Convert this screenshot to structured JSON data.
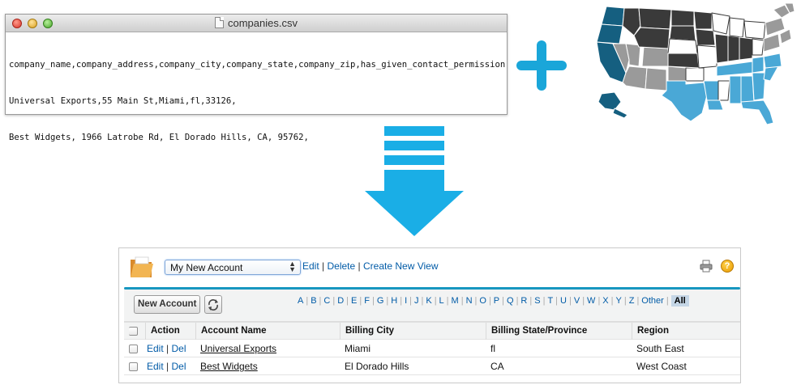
{
  "csv_window": {
    "title": "companies.csv",
    "lines": [
      "company_name,company_address,company_city,company_state,company_zip,has_given_contact_permission",
      "Universal Exports,55 Main St,Miami,fl,33126,",
      "Best Widgets, 1966 Latrobe Rd, El Dorado Hills, CA, 95762,"
    ]
  },
  "colors": {
    "accent_blue": "#1aa6d9",
    "map_dark_teal": "#155f80",
    "map_light_blue": "#4aa8d6",
    "map_gray": "#9a9a9a",
    "map_charcoal": "#3a3a3a",
    "link_blue": "#015ba7",
    "rule_blue": "#1797c0"
  },
  "list_view": {
    "selected_view": "My New Account",
    "edit_link": "Edit",
    "delete_link": "Delete",
    "create_view_link": "Create New View",
    "link_separator": "|",
    "new_button": "New Account",
    "help_label": "?",
    "alphabet": [
      "A",
      "B",
      "C",
      "D",
      "E",
      "F",
      "G",
      "H",
      "I",
      "J",
      "K",
      "L",
      "M",
      "N",
      "O",
      "P",
      "Q",
      "R",
      "S",
      "T",
      "U",
      "V",
      "W",
      "X",
      "Y",
      "Z",
      "Other"
    ],
    "alphabet_selected": "All",
    "columns": [
      "Action",
      "Account Name",
      "Billing City",
      "Billing State/Province",
      "Region"
    ],
    "row_action_edit": "Edit",
    "row_action_del": "Del",
    "rows": [
      {
        "account_name": "Universal Exports",
        "billing_city": "Miami",
        "billing_state": "fl",
        "region": "South East"
      },
      {
        "account_name": "Best Widgets",
        "billing_city": "El Dorado Hills",
        "billing_state": "CA",
        "region": "West Coast"
      }
    ]
  }
}
